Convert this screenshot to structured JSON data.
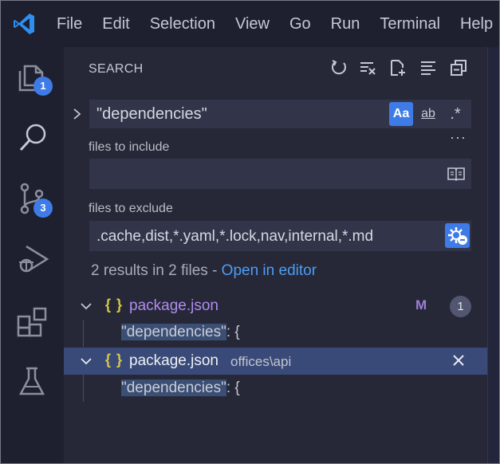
{
  "menu": [
    "File",
    "Edit",
    "Selection",
    "View",
    "Go",
    "Run",
    "Terminal",
    "Help"
  ],
  "activity": {
    "explorer_badge": "1",
    "scm_badge": "3"
  },
  "sidebar": {
    "title": "SEARCH",
    "search_value": "\"dependencies\"",
    "options": {
      "match_case": "Aa",
      "whole_word": "ab",
      "regex": ".*"
    },
    "more": "···",
    "include_label": "files to include",
    "include_value": "",
    "exclude_label": "files to exclude",
    "exclude_value": ".cache,dist,*.yaml,*.lock,nav,internal,*.md",
    "summary_text": "2 results in 2 files - ",
    "summary_link": "Open in editor"
  },
  "results": [
    {
      "icon": "{ }",
      "file": "package.json",
      "path": "",
      "status": "M",
      "count": "1",
      "match_highlight": "\"dependencies\"",
      "match_rest": ": {"
    },
    {
      "icon": "{ }",
      "file": "package.json",
      "path": "offices\\api",
      "status": "",
      "count": "",
      "match_highlight": "\"dependencies\"",
      "match_rest": ": {"
    }
  ],
  "colors": {
    "accent": "#3e7be6",
    "link": "#4d9df5",
    "modified": "#9d7ed6",
    "json_icon": "#d7c84a",
    "selection": "#3a4a78"
  }
}
